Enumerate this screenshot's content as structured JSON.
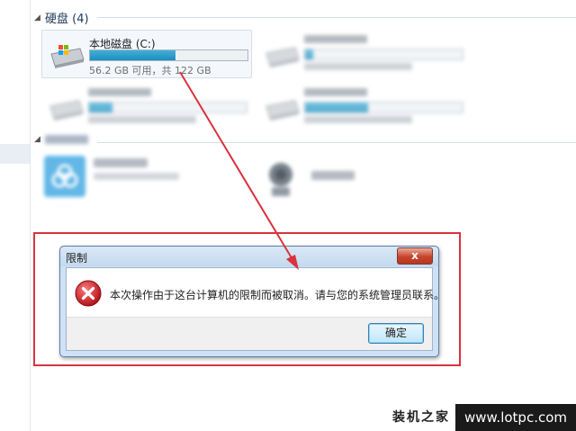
{
  "hard_disk_group": {
    "chevron": "◢",
    "title": "硬盘 (4)"
  },
  "drives": [
    {
      "name": "本地磁盘 (C:)",
      "info": "56.2 GB 可用，共 122 GB",
      "used_fraction": 0.54,
      "blurred": false
    },
    {
      "name": "",
      "info": "",
      "used_fraction": 0.05,
      "blurred": true
    },
    {
      "name": "",
      "info": "",
      "used_fraction": 0.15,
      "blurred": true
    },
    {
      "name": "",
      "info": "",
      "used_fraction": 0.4,
      "blurred": true
    }
  ],
  "other_group": {
    "chevron": "◢",
    "title": ""
  },
  "dialog": {
    "title": "限制",
    "close_label": "x",
    "message": "本次操作由于这台计算机的限制而被取消。请与您的系统管理员联系。",
    "ok_label": "确定"
  },
  "watermark": {
    "cn": "装机之家",
    "url": "www.lotpc.com"
  },
  "colors": {
    "highlight_frame": "#d8333f",
    "arrow": "#d8333f",
    "drive_bar": "#1e8cbf"
  }
}
